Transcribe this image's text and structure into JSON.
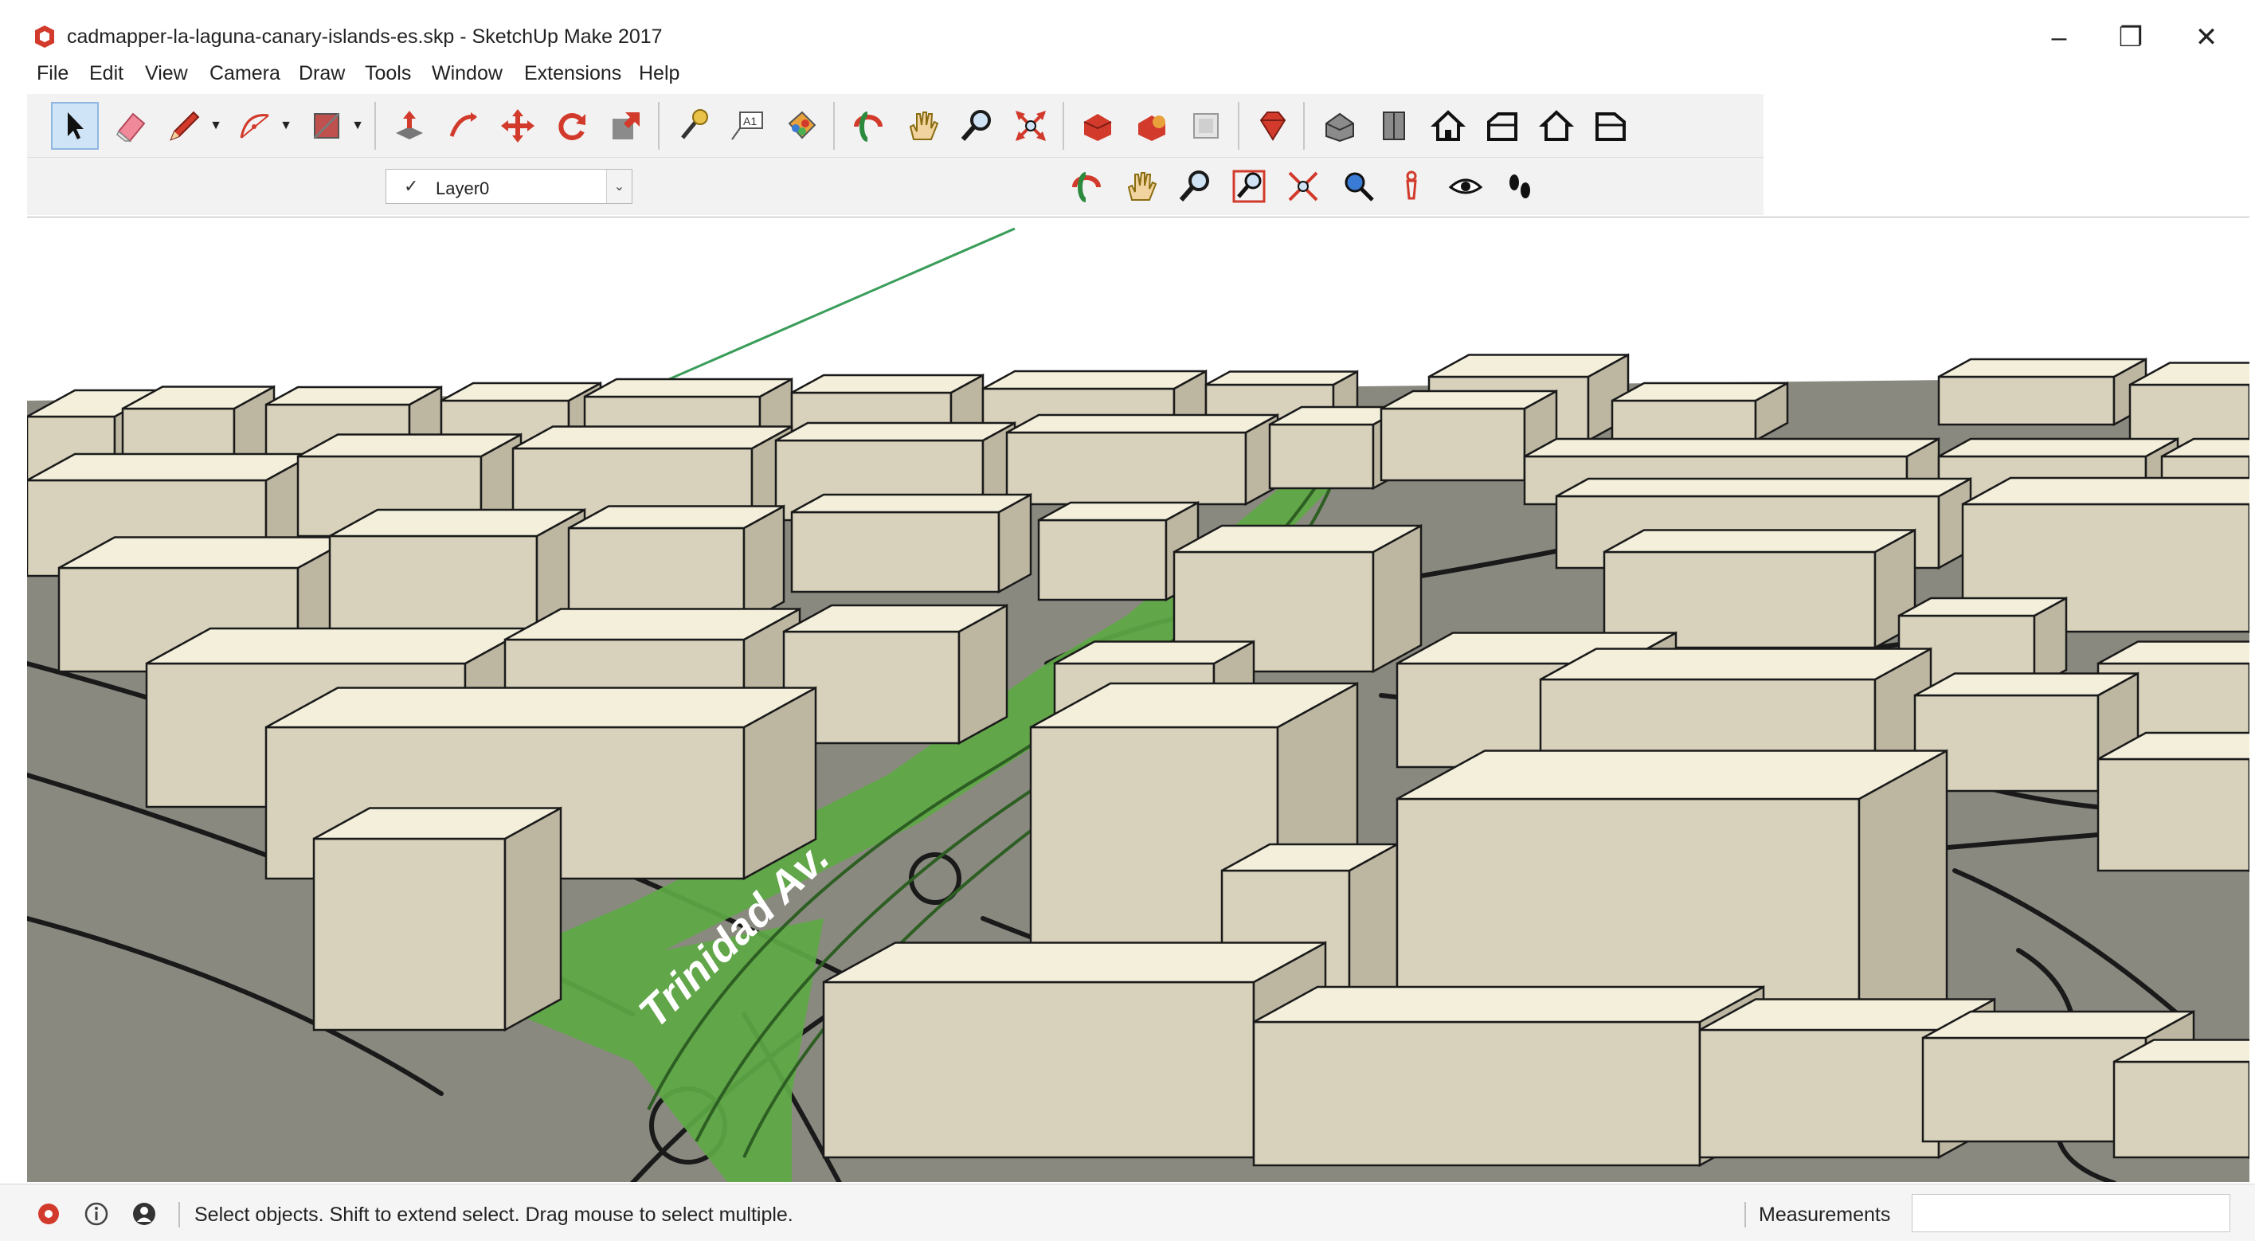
{
  "window": {
    "title": "cadmapper-la-laguna-canary-islands-es.skp - SketchUp Make 2017",
    "minimize_glyph": "–",
    "maximize_glyph": "❐",
    "close_glyph": "✕"
  },
  "menu": {
    "items": [
      "File",
      "Edit",
      "View",
      "Camera",
      "Draw",
      "Tools",
      "Window",
      "Extensions",
      "Help"
    ]
  },
  "toolbar_main": {
    "tools": [
      "select",
      "eraser",
      "line",
      "arc",
      "rectangle",
      "push-pull",
      "follow-me",
      "move",
      "rotate",
      "scale",
      "tape-measure",
      "text",
      "paint-bucket",
      "orbit",
      "pan",
      "zoom",
      "zoom-extents",
      "3d-warehouse",
      "extension-warehouse",
      "layout",
      "ruby-console",
      "iso-view",
      "top-view",
      "front-view",
      "right-view",
      "back-view",
      "left-view"
    ],
    "active_tool": "select"
  },
  "layers": {
    "checkmark": "✓",
    "current_layer": "Layer0",
    "dropdown_glyph": "⌄"
  },
  "toolbar_camera": {
    "tools": [
      "orbit",
      "pan",
      "zoom",
      "zoom-window",
      "zoom-extents",
      "previous",
      "position-camera",
      "look-around",
      "walk"
    ]
  },
  "viewport": {
    "street_label": "Trinidad Av.",
    "colors": {
      "ground": "#8a8980",
      "building_top": "#f3efdb",
      "building_side": "#d8d2bc",
      "building_dark": "#bdb7a2",
      "road_line": "#1a1a1a",
      "highlight_road": "#5ea845",
      "axis_green": "#3a9d5a",
      "sky": "#ffffff"
    }
  },
  "status": {
    "message": "Select objects. Shift to extend select. Drag mouse to select multiple.",
    "measurements_label": "Measurements",
    "measurements_value": ""
  }
}
